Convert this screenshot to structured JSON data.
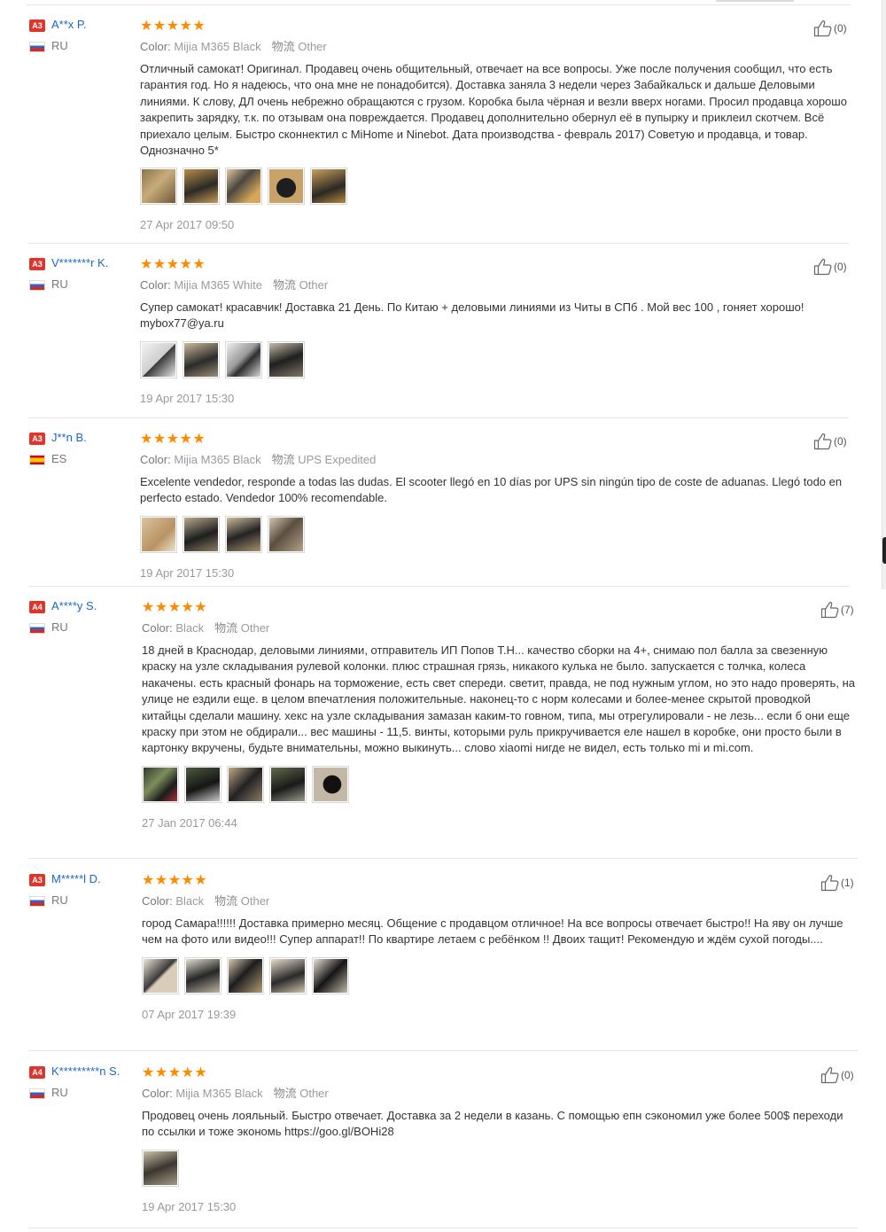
{
  "reviews": [
    {
      "level": "A3",
      "user": "A**x P.",
      "country": "RU",
      "flag": "ru",
      "stars": "★★★★★",
      "color_label": "Color:",
      "color_value": "Mijia M365 Black",
      "shipping_icon": "物流",
      "shipping": "Other",
      "text": "Отличный самокат! Оригинал. Продавец очень общительный, отвечает на все вопросы. Уже после получения сообщил, что есть гарантия год. Но я надеюсь, что она мне не понадобится). Доставка заняла 3 недели через Забайкальск и дальше Деловыми линиями. К слову, ДЛ очень небрежно обращаются с грузом. Коробка была чёрная и везли вверх ногами. Просил продавца хорошо закрепить зарядку, т.к. по отзывам она повреждается. Продавец дополнительно обернул её в пупырку и приклеил скотчем. Всё приехало целым. Быстро сконнектил с MiHome и Ninebot. Дата производства - февраль 2017) Советую и продавца, и товар. Однозначно 5*",
      "photos": [
        {
          "bg": "linear-gradient(135deg,#8a7350,#c9ac7a 45%,#6e5a3a)"
        },
        {
          "bg": "linear-gradient(160deg,#b68d4a,#2c2a26 55%,#c79a58)"
        },
        {
          "bg": "linear-gradient(135deg,#e0c9a0,#4a4640 40%,#d7a85a 80%)"
        },
        {
          "bg": "radial-gradient(circle at 50% 55%,#1e1e1e 0 38%,#c9a26a 40% 100%)"
        },
        {
          "bg": "linear-gradient(160deg,#caa05a,#2a2825 60%,#b8873e)"
        }
      ],
      "date": "27 Apr 2017 09:50",
      "likes": "(0)"
    },
    {
      "level": "A3",
      "user": "V*******r K.",
      "country": "RU",
      "flag": "ru",
      "stars": "★★★★★",
      "color_label": "Color:",
      "color_value": "Mijia M365 White",
      "shipping_icon": "物流",
      "shipping": "Other",
      "text": "Супер самокат! красавчик! Доставка 21 День. По Китаю + деловыми линиями из Читы в СПб . Мой вес 100 , гоняет хорошо! mybox77@ya.ru",
      "photos": [
        {
          "bg": "linear-gradient(135deg,#f2f2f2,#cfcfcf 50%,#3a3a3a 52%,#e8e8e8)"
        },
        {
          "bg": "linear-gradient(160deg,#c9b99a,#2b2b2b 55%,#9a8c76)"
        },
        {
          "bg": "linear-gradient(135deg,#eeeeee,#9a9a9a 45%,#2e2e2e 60%,#d9d9d9)"
        },
        {
          "bg": "linear-gradient(160deg,#c5bcaa,#1f1f1f 50%,#807565)"
        }
      ],
      "date": "19 Apr 2017 15:30",
      "likes": "(0)"
    },
    {
      "level": "A3",
      "user": "J**n B.",
      "country": "ES",
      "flag": "es",
      "stars": "★★★★★",
      "color_label": "Color:",
      "color_value": "Mijia M365 Black",
      "shipping_icon": "物流",
      "shipping": "UPS Expedited",
      "text": "Excelente vendedor, responde a todas las dudas. El scooter llegó en 10 días por UPS sin ningún tipo de coste de aduanas. Llegó todo en perfecto estado. Vendedor 100% recomendable.",
      "photos": [
        {
          "bg": "linear-gradient(135deg,#d9c3a0,#b89262 60%,#efe3cf)"
        },
        {
          "bg": "linear-gradient(160deg,#b9a98c,#1e1e1e 55%,#8d7c62)"
        },
        {
          "bg": "linear-gradient(160deg,#cdbb9c,#232323 50%,#a58f6e)"
        },
        {
          "bg": "linear-gradient(135deg,#d4c6b0,#5a4e40 45%,#b3a289)"
        }
      ],
      "date": "19 Apr 2017 15:30",
      "likes": "(0)"
    },
    {
      "level": "A4",
      "user": "A****y S.",
      "country": "RU",
      "flag": "ru",
      "stars": "★★★★★",
      "color_label": "Color:",
      "color_value": "Black",
      "shipping_icon": "物流",
      "shipping": "Other",
      "text": "18 дней в Краснодар, деловыми линиями, отправитель ИП Попов Т.Н... качество сборки на 4+, снимаю пол балла за свезенную краску на узле складывания рулевой колонки. плюс страшная грязь, никакого кулька не было. запускается с толчка, колеса накачены. есть красный фонарь на торможение, есть свет спереди. светит, правда, не под нужным углом, но это надо проверять, на улице не ездили еще. в целом впечатления положительные. наконец-то с норм колесами и более-менее скрытой проводкой китайцы сделали машину. хекс на узле складывания замазан каким-то говном, типа, мы отрегулировали - не лезь... если б они еще краску при этом не обдирали... вес машины - 11,5. винты, которыми руль прикручивается еле нашел в коробке, они просто были в картонку вкручены, будьте внимательны, можно выкинуть... слово xiaomi нигде не видел, есть только mi и mi.com.",
      "photos": [
        {
          "bg": "linear-gradient(135deg,#2f3a2a,#7d8f5c 40%,#1c1c1c 70%,#a33)"
        },
        {
          "bg": "linear-gradient(160deg,#4b5a3e,#151515 55%,#c9c9c9)"
        },
        {
          "bg": "linear-gradient(135deg,#c2a98a,#222 50%,#8a7a66)"
        },
        {
          "bg": "linear-gradient(160deg,#606a4a,#1a1a1a 55%,#9a9a8a)"
        },
        {
          "bg": "radial-gradient(circle at 55% 50%,#111 0 35%,#c3b8a6 38% 100%)"
        }
      ],
      "date": "27 Jan 2017 06:44",
      "likes": "(7)"
    },
    {
      "level": "A3",
      "user": "M*****l D.",
      "country": "RU",
      "flag": "ru",
      "stars": "★★★★★",
      "color_label": "Color:",
      "color_value": "Black",
      "shipping_icon": "物流",
      "shipping": "Other",
      "text": "город Самара!!!!!! Доставка примерно месяц. Общение с продавцом отличное! На все вопросы отвечает быстро!! На яву он лучше чем на фото или видео!!! Супер аппарат!! По квартире летаем с ребёнком !! Двоих тащит! Рекомендую и ждём сухой погоды....",
      "photos": [
        {
          "bg": "linear-gradient(135deg,#efe6d8,#3a3a3a 48%,#d9cdb9 55%)"
        },
        {
          "bg": "linear-gradient(160deg,#e3ddd0,#262626 50%,#bdb3a2)"
        },
        {
          "bg": "linear-gradient(135deg,#d7c9b0,#1d1d1d 45%,#b49c78)"
        },
        {
          "bg": "linear-gradient(160deg,#e6dccb,#2a2a2a 55%,#cfc2aa)"
        },
        {
          "bg": "linear-gradient(135deg,#e9e1d3,#151515 50%,#bfb6a6)"
        }
      ],
      "date": "07 Apr 2017 19:39",
      "likes": "(1)"
    },
    {
      "level": "A4",
      "user": "K*********n S.",
      "country": "RU",
      "flag": "ru",
      "stars": "★★★★★",
      "color_label": "Color:",
      "color_value": "Mijia M365 Black",
      "shipping_icon": "物流",
      "shipping": "Other",
      "text": "Продовец очень лояльный. Быстро отвечает. Доставка за 2 недели в казань. С помощью епн сэкономил уже более 500$ переходи по ссылки и тоже экономь https://goo.gl/BOHi28",
      "photos": [
        {
          "bg": "linear-gradient(160deg,#cbbfa8,#3b3630 50%,#a69a86)"
        }
      ],
      "date": "19 Apr 2017 15:30",
      "likes": "(0)"
    }
  ]
}
